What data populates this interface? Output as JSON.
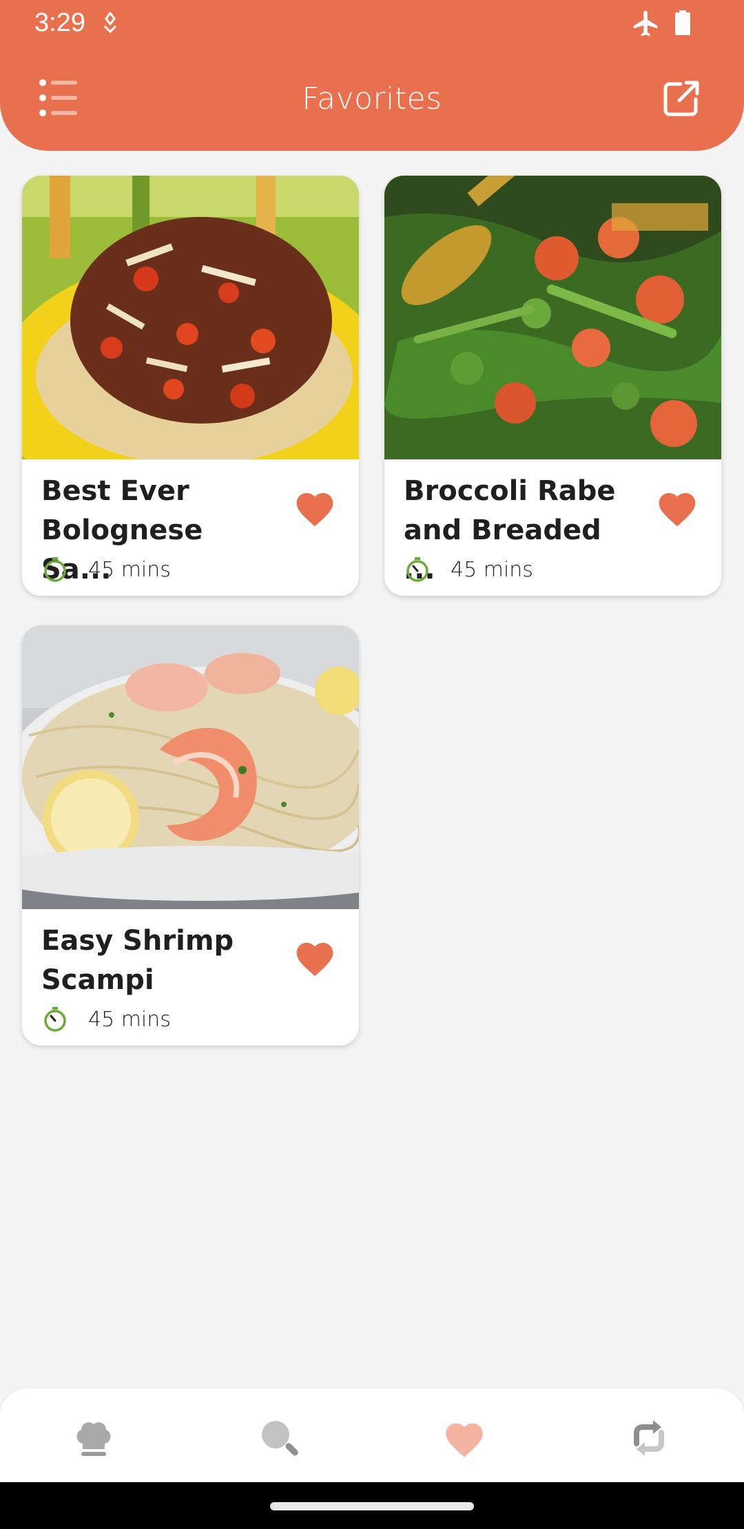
{
  "status_bar": {
    "time": "3:29"
  },
  "header": {
    "title": "Favorites"
  },
  "recipes": [
    {
      "title": "Best Ever\nBolognese Sa...",
      "time": "45 mins"
    },
    {
      "title": "Broccoli Rabe\nand Breaded ...",
      "time": "45 mins"
    },
    {
      "title": "Easy Shrimp\nScampi",
      "time": "45 mins"
    }
  ],
  "bottom_nav": {
    "items": [
      "chef-hat-icon",
      "search-icon",
      "heart-icon",
      "sync-icon"
    ],
    "active": "heart-icon"
  },
  "colors": {
    "accent": "#e8704f",
    "timer": "#6aaa3a",
    "background": "#f4f4f4"
  }
}
